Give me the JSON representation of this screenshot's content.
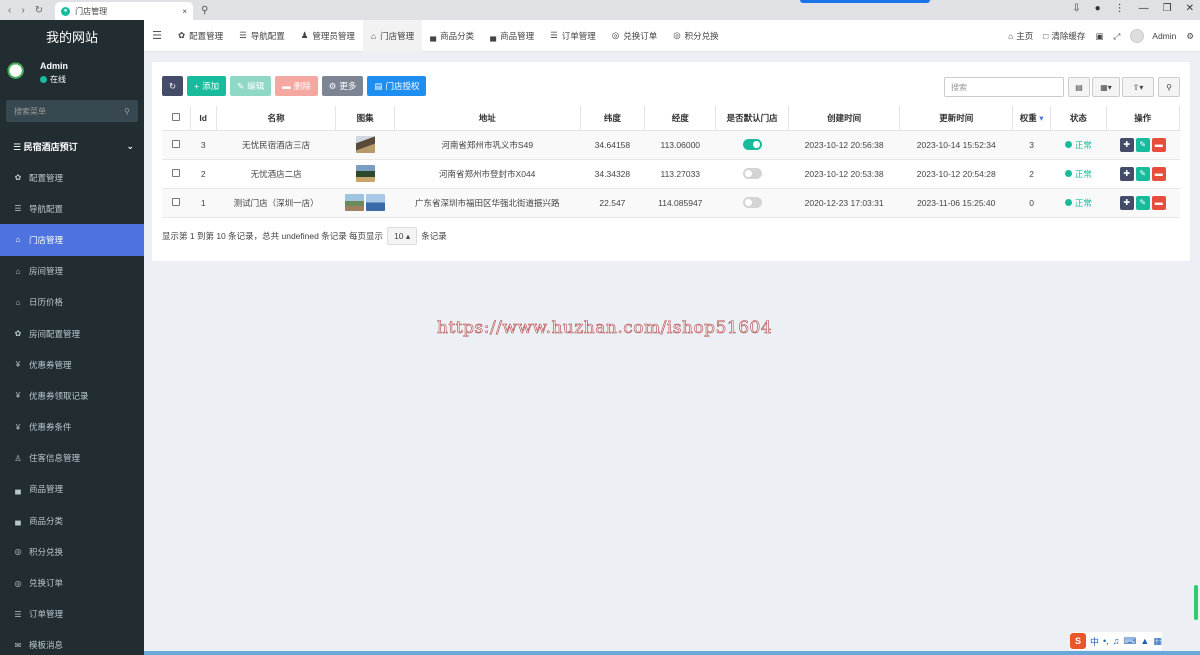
{
  "browser": {
    "tab_title": "门店管理",
    "close": "×",
    "newtab": "+"
  },
  "sidebar": {
    "logo": "我的网站",
    "user_name": "Admin",
    "user_status": "在线",
    "search_placeholder": "搜索菜单",
    "group": "民宿酒店预订",
    "items": [
      {
        "label": "配置管理",
        "icon": "gear-icon",
        "glyph": "✿"
      },
      {
        "label": "导航配置",
        "icon": "list-icon",
        "glyph": "☰"
      },
      {
        "label": "门店管理",
        "icon": "bank-icon",
        "glyph": "⌂",
        "active": true
      },
      {
        "label": "房间管理",
        "icon": "home-icon",
        "glyph": "⌂"
      },
      {
        "label": "日历价格",
        "icon": "home-icon",
        "glyph": "⌂"
      },
      {
        "label": "房间配置管理",
        "icon": "gear-icon",
        "glyph": "✿"
      },
      {
        "label": "优惠券管理",
        "icon": "yen-icon",
        "glyph": "¥"
      },
      {
        "label": "优惠券领取记录",
        "icon": "yen-icon",
        "glyph": "¥"
      },
      {
        "label": "优惠券条件",
        "icon": "yen-icon",
        "glyph": "¥"
      },
      {
        "label": "住客信息管理",
        "icon": "user-icon",
        "glyph": "♙"
      },
      {
        "label": "商品管理",
        "icon": "cart-icon",
        "glyph": "▄"
      },
      {
        "label": "商品分类",
        "icon": "cart-icon",
        "glyph": "▄"
      },
      {
        "label": "积分兑换",
        "icon": "coin-icon",
        "glyph": "◎"
      },
      {
        "label": "兑换订单",
        "icon": "coin-icon",
        "glyph": "◎"
      },
      {
        "label": "订单管理",
        "icon": "list-icon",
        "glyph": "☰"
      },
      {
        "label": "模板消息",
        "icon": "envelope-icon",
        "glyph": "✉"
      }
    ]
  },
  "topnav": {
    "tabs": [
      {
        "label": "配置管理",
        "glyph": "✿"
      },
      {
        "label": "导航配置",
        "glyph": "☰"
      },
      {
        "label": "管理员管理",
        "glyph": "♟"
      },
      {
        "label": "门店管理",
        "glyph": "⌂",
        "active": true
      },
      {
        "label": "商品分类",
        "glyph": "▄"
      },
      {
        "label": "商品管理",
        "glyph": "▄"
      },
      {
        "label": "订单管理",
        "glyph": "☰"
      },
      {
        "label": "兑换订单",
        "glyph": "◎"
      },
      {
        "label": "积分兑换",
        "glyph": "◎"
      }
    ],
    "home": "主页",
    "clear_cache": "清除缓存",
    "admin": "Admin"
  },
  "toolbar": {
    "add": "添加",
    "edit": "编辑",
    "delete": "删除",
    "more": "更多",
    "authorize": "门店授权",
    "search_placeholder": "搜索"
  },
  "table": {
    "headers": [
      "Id",
      "名称",
      "图集",
      "地址",
      "纬度",
      "经度",
      "是否默认门店",
      "创建时间",
      "更新时间",
      "权重",
      "状态",
      "操作"
    ],
    "rows": [
      {
        "id": "3",
        "name": "无忧民宿酒店三店",
        "address": "河南省郑州市巩义市S49",
        "lat": "34.64158",
        "lng": "113.06000",
        "is_default": true,
        "created": "2023-10-12 20:56:38",
        "updated": "2023-10-14 15:52:34",
        "weight": "3",
        "status": "正常"
      },
      {
        "id": "2",
        "name": "无忧酒店二店",
        "address": "河南省郑州市登封市X044",
        "lat": "34.34328",
        "lng": "113.27033",
        "is_default": false,
        "created": "2023-10-12 20:53:38",
        "updated": "2023-10-12 20:54:28",
        "weight": "2",
        "status": "正常"
      },
      {
        "id": "1",
        "name": "测试门店（深圳一店）",
        "address": "广东省深圳市福田区华强北街道振兴路",
        "lat": "22.547",
        "lng": "114.085947",
        "is_default": false,
        "created": "2020-12-23 17:03:31",
        "updated": "2023-11-06 15:25:40",
        "weight": "0",
        "status": "正常"
      }
    ]
  },
  "pager": {
    "summary": "显示第 1 到第 10 条记录，总共 undefined 条记录 每页显示",
    "page_size": "10",
    "suffix": "条记录"
  },
  "watermark": "https://www.huzhan.com/ishop51604",
  "tray": {
    "lang": "中",
    "punct": "•,"
  }
}
